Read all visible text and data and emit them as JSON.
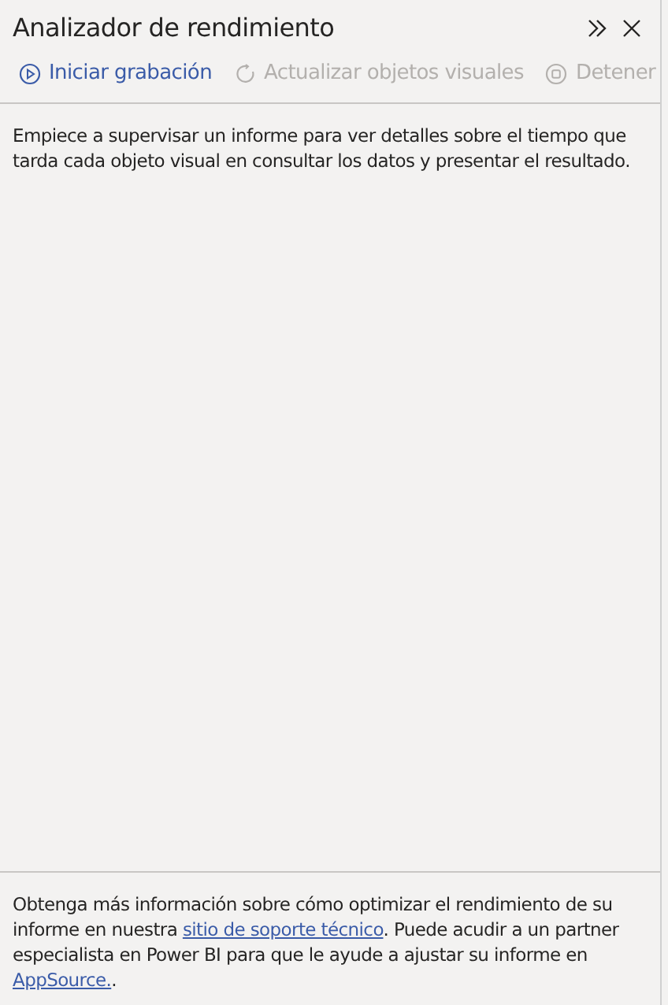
{
  "panel": {
    "title": "Analizador de rendimiento"
  },
  "toolbar": [
    {
      "kind": "play",
      "label": "Iniciar grabación",
      "disabled": false
    },
    {
      "kind": "refresh",
      "label": "Actualizar objetos visuales",
      "disabled": true
    },
    {
      "kind": "stop",
      "label": "Detener",
      "disabled": true
    }
  ],
  "intro": "Empiece a supervisar un informe para ver detalles sobre el tiempo que tarda cada objeto visual en consultar los datos y presentar el resultado.",
  "footer": [
    {
      "kind": "text",
      "text": "Obtenga más información sobre cómo optimizar el rendimiento de su informe en nuestra "
    },
    {
      "kind": "link",
      "text": "sitio de soporte técnico"
    },
    {
      "kind": "text",
      "text": ". Puede acudir a un partner especialista en Power BI para que le ayude a ajustar su informe en "
    },
    {
      "kind": "link",
      "text": "AppSource."
    },
    {
      "kind": "text",
      "text": "."
    }
  ]
}
